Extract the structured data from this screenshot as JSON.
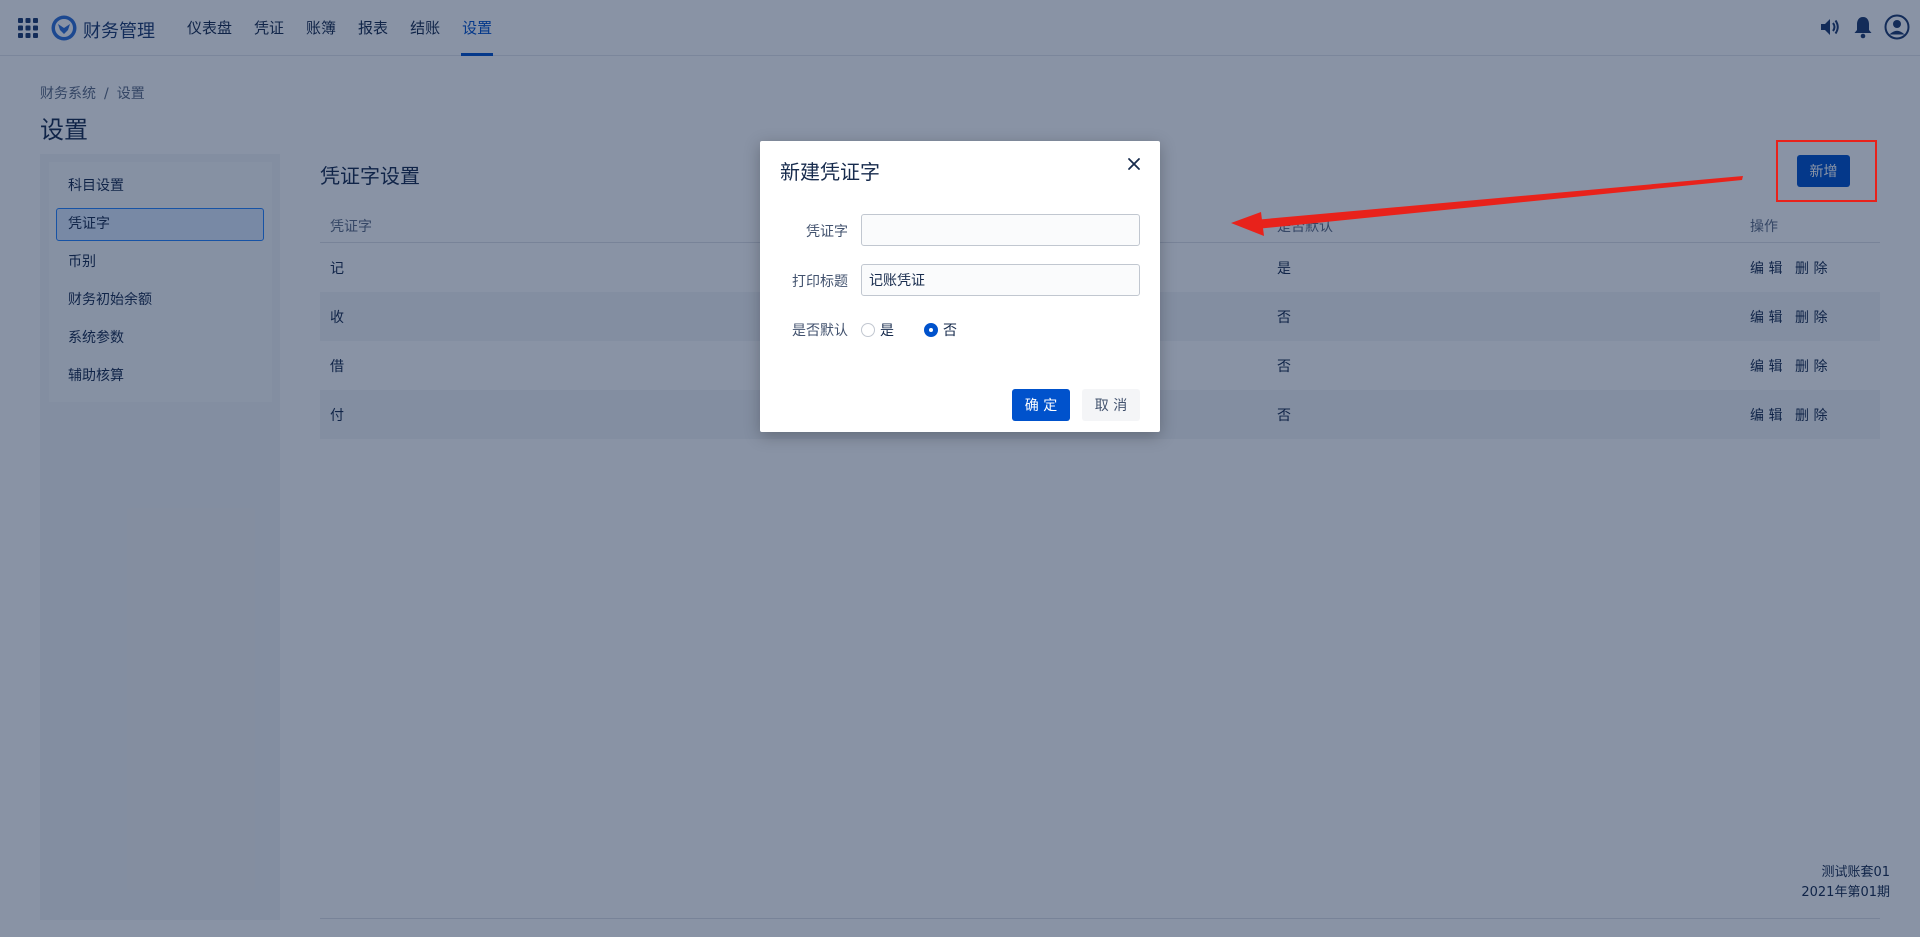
{
  "header": {
    "app_title": "财务管理",
    "nav": [
      "仪表盘",
      "凭证",
      "账簿",
      "报表",
      "结账",
      "设置"
    ],
    "active_nav": "设置"
  },
  "breadcrumb": {
    "root": "财务系统",
    "sep": "/",
    "current": "设置"
  },
  "page_title": "设置",
  "left_menu": [
    "科目设置",
    "凭证字",
    "币别",
    "财务初始余额",
    "系统参数",
    "辅助核算"
  ],
  "active_menu": "凭证字",
  "section_title": "凭证字设置",
  "add_button": "新增",
  "table": {
    "headers": [
      "凭证字",
      "是否默认",
      "操作"
    ],
    "rows": [
      {
        "word": "记",
        "default": "是"
      },
      {
        "word": "收",
        "default": "否"
      },
      {
        "word": "借",
        "default": "否"
      },
      {
        "word": "付",
        "default": "否"
      }
    ],
    "op_edit": "编 辑",
    "op_delete": "删 除"
  },
  "footer": {
    "account_set": "测试账套01",
    "period": "2021年第01期"
  },
  "dialog": {
    "title": "新建凭证字",
    "field_word_label": "凭证字",
    "field_word_value": "",
    "field_print_label": "打印标题",
    "field_print_value": "记账凭证",
    "default_label": "是否默认",
    "option_yes": "是",
    "option_no": "否",
    "selected": "否",
    "ok": "确 定",
    "cancel": "取 消"
  },
  "colors": {
    "primary": "#0052cc",
    "annotation_red": "#e8221b",
    "overlay": "rgba(9,30,66,0.48)"
  }
}
